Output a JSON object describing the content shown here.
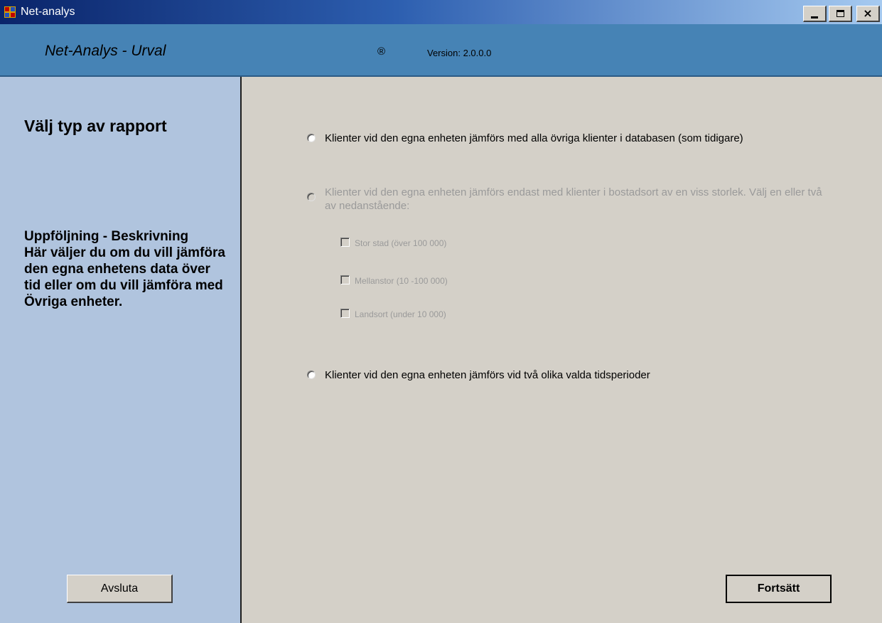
{
  "window": {
    "title": "Net-analys",
    "controls": {
      "minimize": "minimize",
      "maximize": "maximize",
      "close": "×"
    }
  },
  "header": {
    "app_name": "Net-Analys - Urval",
    "registered_mark": "®",
    "version": "Version: 2.0.0.0"
  },
  "sidebar": {
    "heading": "Välj typ av rapport",
    "description_title": "Uppföljning - Beskrivning",
    "description": "Här väljer du om du vill jämföra den egna enhetens data över tid eller om du vill jämföra med Övriga enheter.",
    "exit_button": "Avsluta"
  },
  "main": {
    "options": [
      {
        "label": "Klienter vid den egna enheten jämförs med alla övriga klienter i databasen (som tidigare)",
        "enabled": true,
        "selected": false
      },
      {
        "label": "Klienter vid den egna enheten jämförs endast med klienter i bostadsort av en viss storlek. Välj en eller två av nedanstående:",
        "enabled": false,
        "selected": false
      },
      {
        "label": "Klienter vid den egna enheten jämförs vid två olika valda tidsperioder",
        "enabled": true,
        "selected": false
      }
    ],
    "size_checkboxes": [
      {
        "label": "Stor stad (över 100 000)",
        "checked": false,
        "enabled": false
      },
      {
        "label": "Mellanstor (10 -100 000)",
        "checked": false,
        "enabled": false
      },
      {
        "label": "Landsort (under 10 000)",
        "checked": false,
        "enabled": false
      }
    ],
    "continue_button": "Fortsätt"
  },
  "colors": {
    "header_bg": "#4683b5",
    "sidebar_bg": "#b0c4de",
    "main_bg": "#d4d0c8",
    "disabled_text": "#9a9a9a"
  }
}
